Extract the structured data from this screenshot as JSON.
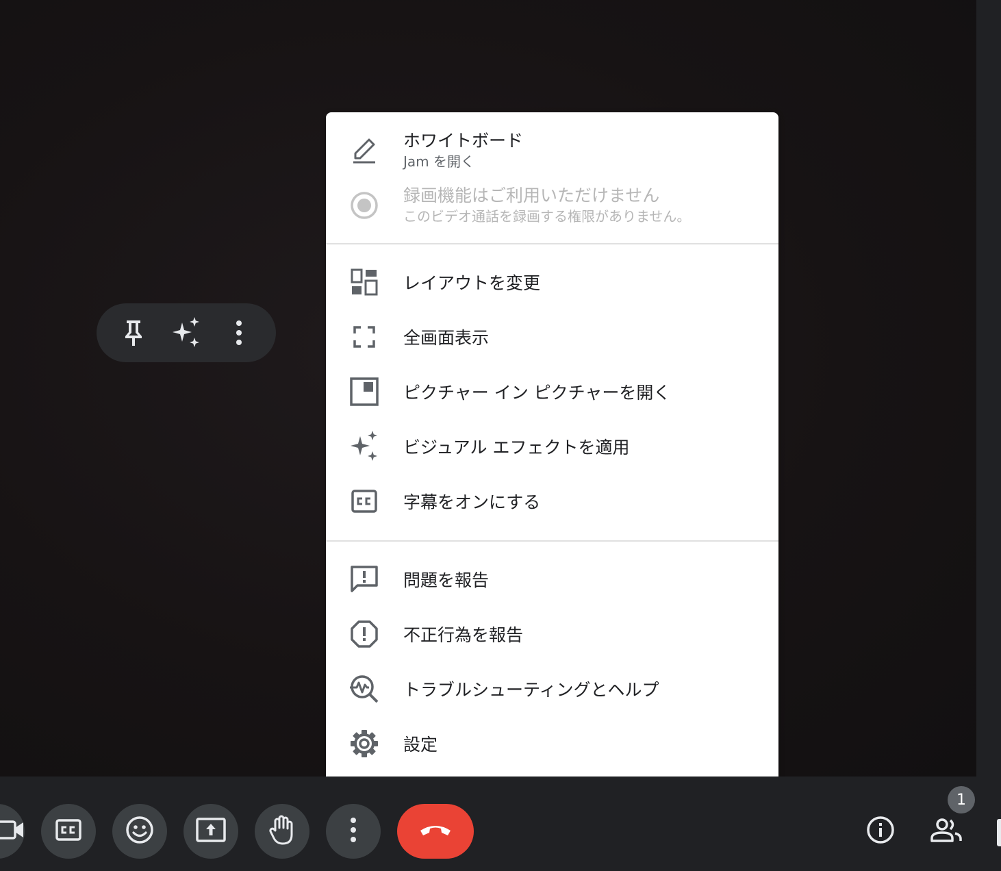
{
  "menu": {
    "whiteboard": {
      "title": "ホワイトボード",
      "subtitle": "Jam を開く",
      "icon": "pencil-icon"
    },
    "recording": {
      "title": "録画機能はご利用いただけません",
      "subtitle": "このビデオ通話を録画する権限がありません。",
      "icon": "record-icon",
      "disabled": true
    },
    "items_group2": [
      {
        "label": "レイアウトを変更",
        "icon": "layout-icon"
      },
      {
        "label": "全画面表示",
        "icon": "fullscreen-icon"
      },
      {
        "label": "ピクチャー イン ピクチャーを開く",
        "icon": "picture-in-picture-icon"
      },
      {
        "label": "ビジュアル エフェクトを適用",
        "icon": "sparkle-icon"
      },
      {
        "label": "字幕をオンにする",
        "icon": "closed-caption-icon"
      }
    ],
    "items_group3": [
      {
        "label": "問題を報告",
        "icon": "feedback-icon"
      },
      {
        "label": "不正行為を報告",
        "icon": "report-abuse-icon"
      },
      {
        "label": "トラブルシューティングとヘルプ",
        "icon": "troubleshoot-icon"
      },
      {
        "label": "設定",
        "icon": "gear-icon"
      }
    ]
  },
  "tile_controls": [
    "pin-icon",
    "sparkle-icon",
    "more-vert-icon"
  ],
  "bottom_bar": {
    "buttons": [
      "camera-icon",
      "closed-caption-icon",
      "emoji-icon",
      "present-screen-icon",
      "raise-hand-icon",
      "more-vert-icon",
      "end-call-icon"
    ],
    "right": [
      "info-icon",
      "people-icon"
    ],
    "participant_count": "1"
  },
  "colors": {
    "end_call": "#ea4335",
    "control_bg": "#3c4043",
    "bar_bg": "#202124"
  }
}
